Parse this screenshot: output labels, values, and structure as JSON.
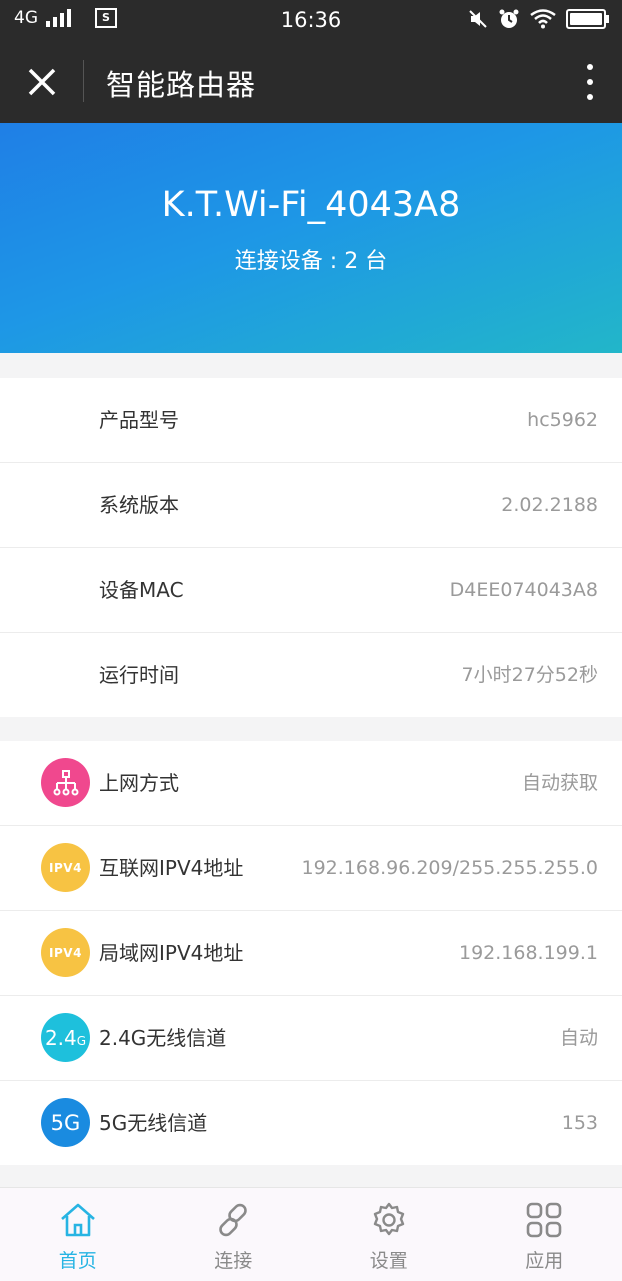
{
  "status_bar": {
    "network": "4G",
    "time": "16:36",
    "icons": [
      "signal-icon",
      "screenshot-icon",
      "mute-icon",
      "alarm-icon",
      "wifi-icon",
      "battery-icon"
    ]
  },
  "header": {
    "title": "智能路由器",
    "close_icon": "close-icon",
    "more_icon": "more-vertical-icon"
  },
  "hero": {
    "ssid": "K.T.Wi-Fi_4043A8",
    "devices": "连接设备 : 2 台",
    "gradient": [
      "#1f7fe6",
      "#22b6c9"
    ]
  },
  "device_info": [
    {
      "label": "产品型号",
      "value": "hc5962"
    },
    {
      "label": "系统版本",
      "value": "2.02.2188"
    },
    {
      "label": "设备MAC",
      "value": "D4EE074043A8"
    },
    {
      "label": "运行时间",
      "value": "7小时27分52秒"
    }
  ],
  "network_info": [
    {
      "label": "上网方式",
      "value": "自动获取",
      "icon": "network-topology-icon",
      "badge": "",
      "color": "#f0488e"
    },
    {
      "label": "互联网IPV4地址",
      "value": "192.168.96.209/255.255.255.0",
      "icon": "ipv4-icon",
      "badge": "IPV4",
      "color": "#f7c343"
    },
    {
      "label": "局域网IPV4地址",
      "value": "192.168.199.1",
      "icon": "ipv4-icon",
      "badge": "IPV4",
      "color": "#f7c343"
    },
    {
      "label": "2.4G无线信道",
      "value": "自动",
      "icon": "wifi-2-4g-icon",
      "badge": "2.4",
      "badge_suffix": "G",
      "color": "#1ec0dc"
    },
    {
      "label": "5G无线信道",
      "value": "153",
      "icon": "wifi-5g-icon",
      "badge": "5G",
      "color": "#1a8be0"
    }
  ],
  "bottom_nav": {
    "active_color": "#27b4e3",
    "items": [
      {
        "label": "首页",
        "icon": "home-icon",
        "active": true
      },
      {
        "label": "连接",
        "icon": "link-icon",
        "active": false
      },
      {
        "label": "设置",
        "icon": "gear-icon",
        "active": false
      },
      {
        "label": "应用",
        "icon": "apps-grid-icon",
        "active": false
      }
    ]
  }
}
